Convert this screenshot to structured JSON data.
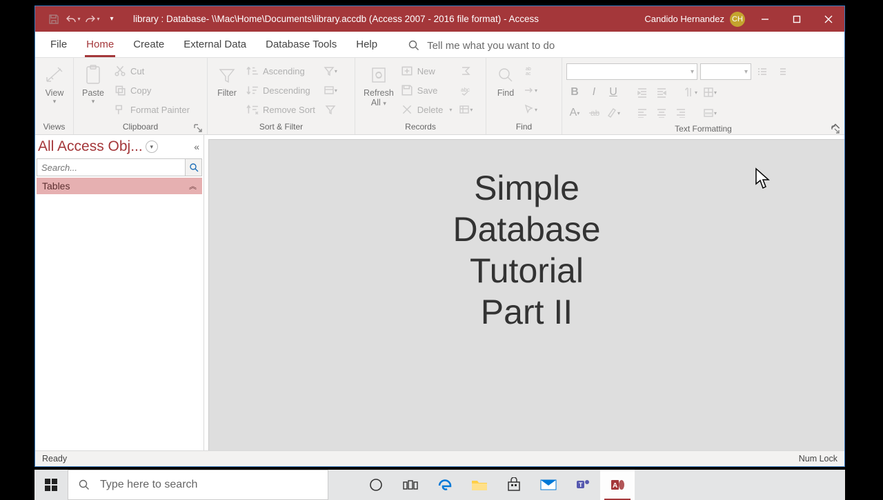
{
  "titlebar": {
    "title": "library : Database- \\\\Mac\\Home\\Documents\\library.accdb (Access 2007 - 2016 file format)  -  Access",
    "user": "Candido Hernandez",
    "initials": "CH"
  },
  "menu": {
    "tabs": [
      "File",
      "Home",
      "Create",
      "External Data",
      "Database Tools",
      "Help"
    ],
    "active_index": 1,
    "tellme": "Tell me what you want to do"
  },
  "ribbon": {
    "views": {
      "view": "View",
      "group": "Views"
    },
    "clipboard": {
      "paste": "Paste",
      "cut": "Cut",
      "copy": "Copy",
      "format_painter": "Format Painter",
      "group": "Clipboard"
    },
    "sortfilter": {
      "filter": "Filter",
      "asc": "Ascending",
      "desc": "Descending",
      "remove": "Remove Sort",
      "group": "Sort & Filter"
    },
    "records": {
      "refresh": "Refresh",
      "refresh2": "All",
      "new": "New",
      "save": "Save",
      "delete": "Delete",
      "group": "Records"
    },
    "find": {
      "find": "Find",
      "group": "Find"
    },
    "textfmt": {
      "group": "Text Formatting"
    }
  },
  "navpane": {
    "title": "All Access Obj...",
    "search_placeholder": "Search...",
    "group": "Tables"
  },
  "canvas": {
    "lines": [
      "Simple",
      "Database",
      "Tutorial",
      "Part II"
    ]
  },
  "statusbar": {
    "left": "Ready",
    "right": "Num Lock"
  },
  "taskbar": {
    "search_placeholder": "Type here to search"
  }
}
